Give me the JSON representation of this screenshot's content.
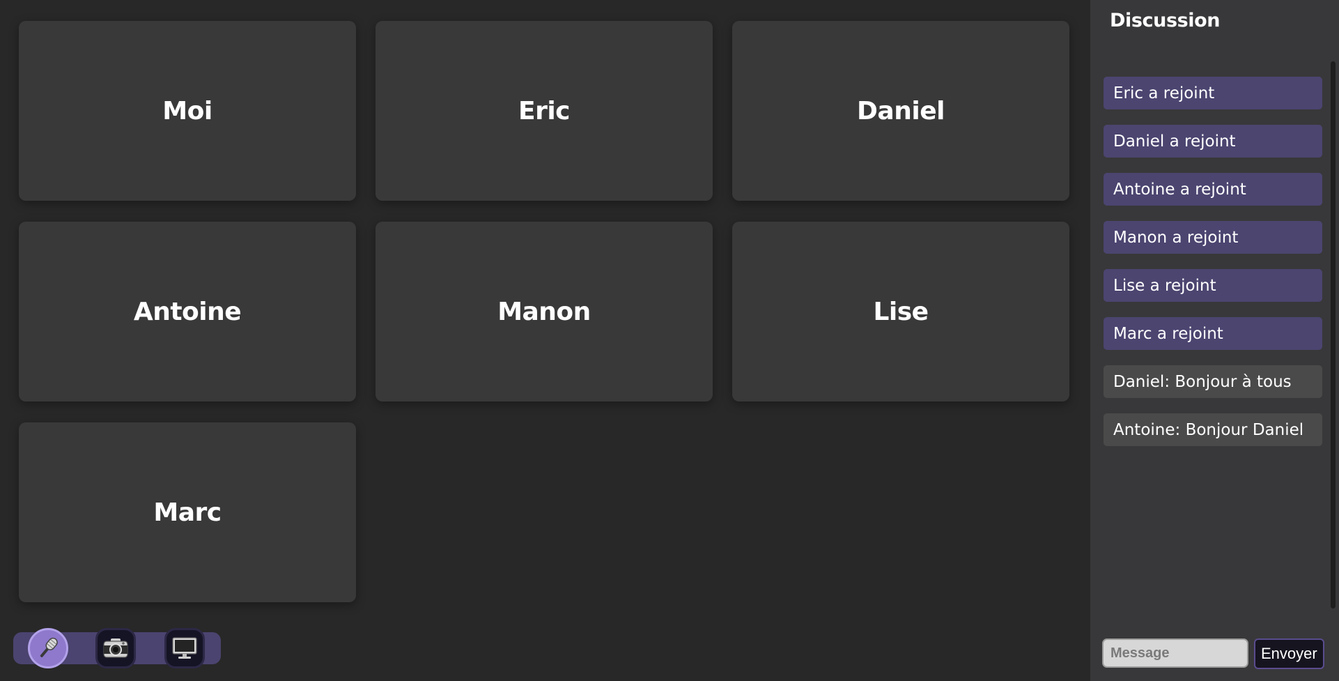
{
  "participants": [
    {
      "name": "Moi"
    },
    {
      "name": "Eric"
    },
    {
      "name": "Daniel"
    },
    {
      "name": "Antoine"
    },
    {
      "name": "Manon"
    },
    {
      "name": "Lise"
    },
    {
      "name": "Marc"
    }
  ],
  "controls": {
    "microphone": {
      "icon": "microphone-icon",
      "active": true
    },
    "camera": {
      "icon": "camera-icon",
      "active": false
    },
    "screen_share": {
      "icon": "monitor-icon",
      "active": false
    }
  },
  "chat": {
    "title": "Discussion",
    "messages": [
      {
        "text": "Eric a rejoint",
        "kind": "system"
      },
      {
        "text": "Daniel a rejoint",
        "kind": "system"
      },
      {
        "text": "Antoine a rejoint",
        "kind": "system"
      },
      {
        "text": "Manon a rejoint",
        "kind": "system"
      },
      {
        "text": "Lise a rejoint",
        "kind": "system"
      },
      {
        "text": "Marc a rejoint",
        "kind": "system"
      },
      {
        "text": "Daniel: Bonjour à tous",
        "kind": "chat"
      },
      {
        "text": "Antoine: Bonjour Daniel",
        "kind": "chat"
      }
    ],
    "input_placeholder": "Message",
    "input_value": "",
    "send_label": "Envoyer"
  },
  "colors": {
    "background": "#282828",
    "tile": "#393939",
    "sidebar": "#38383a",
    "system_message": "#4b4570",
    "chat_message": "#4a4a4a",
    "accent": "#8e79cc"
  }
}
